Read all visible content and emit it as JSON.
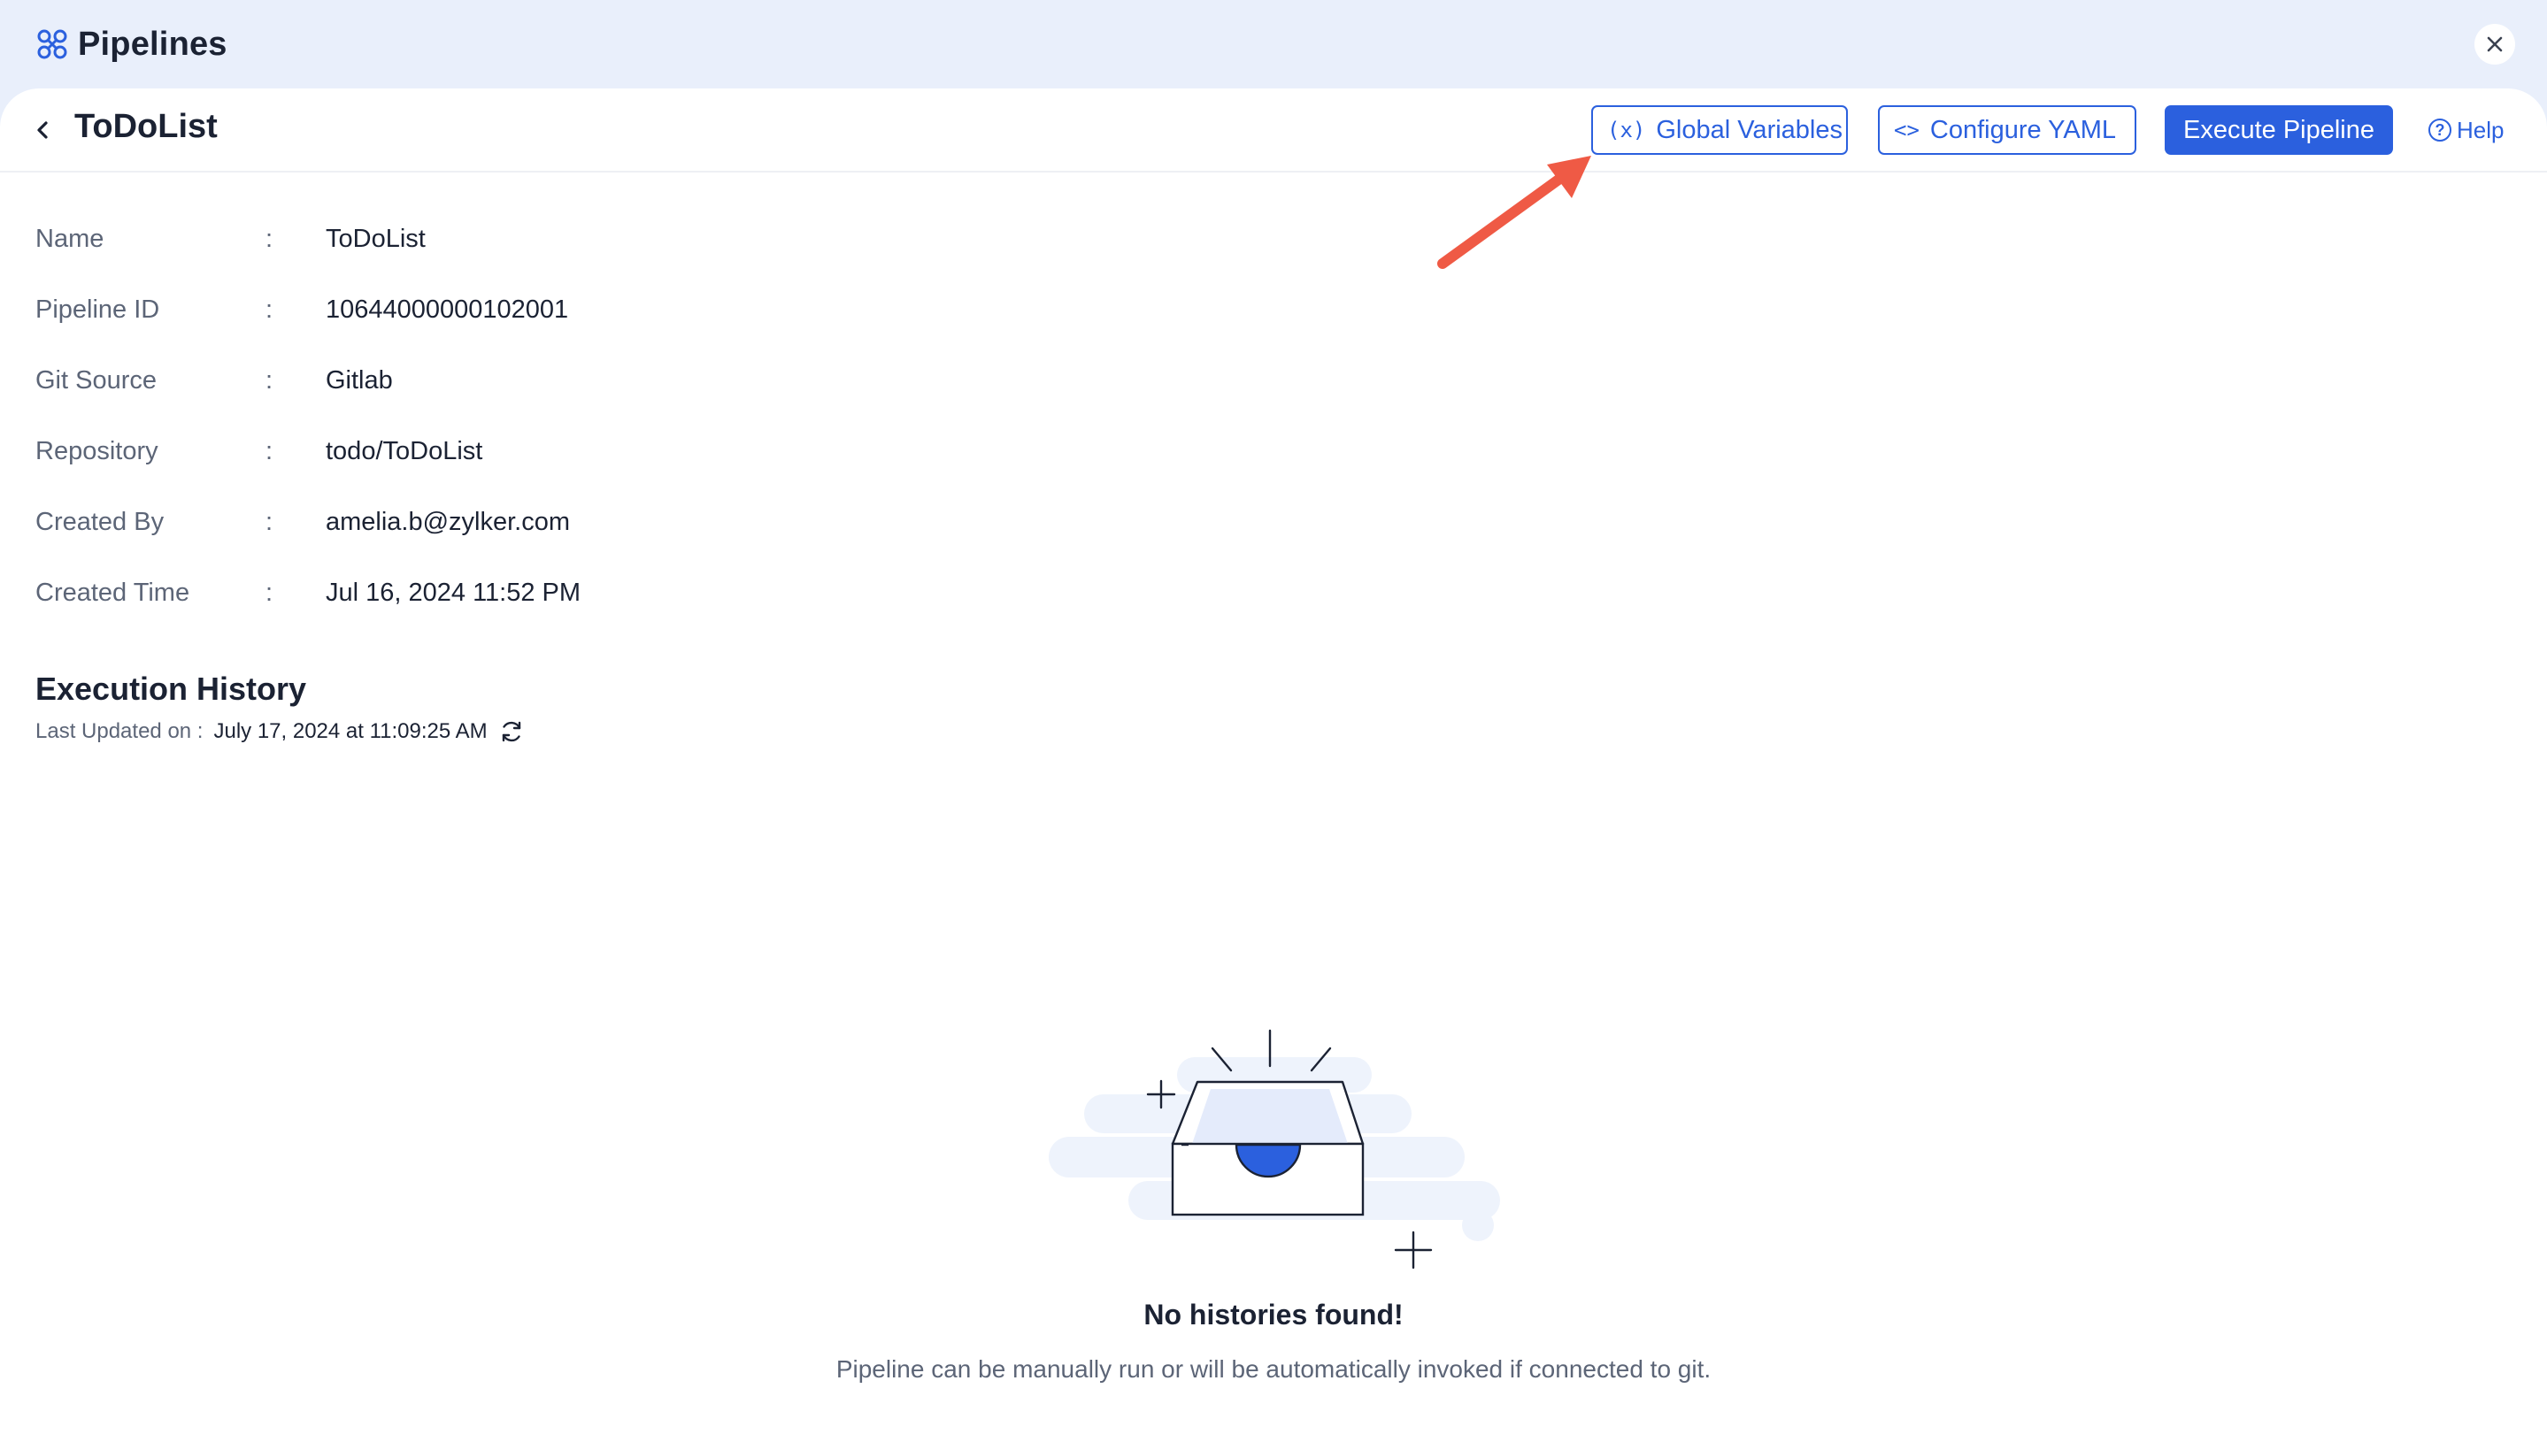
{
  "app": {
    "title": "Pipelines"
  },
  "header": {
    "pipeline_name": "ToDoList",
    "buttons": {
      "global_variables": "Global Variables",
      "global_variables_icon": "(x)",
      "configure_yaml": "Configure YAML",
      "configure_yaml_icon": "<>",
      "execute_pipeline": "Execute Pipeline",
      "help": "Help"
    }
  },
  "details": [
    {
      "label": "Name",
      "value": "ToDoList"
    },
    {
      "label": "Pipeline ID",
      "value": "10644000000102001"
    },
    {
      "label": "Git Source",
      "value": "Gitlab"
    },
    {
      "label": "Repository",
      "value": "todo/ToDoList"
    },
    {
      "label": "Created By",
      "value": "amelia.b@zylker.com"
    },
    {
      "label": "Created Time",
      "value": "Jul 16, 2024 11:52 PM"
    }
  ],
  "history": {
    "title": "Execution History",
    "last_updated_label": "Last Updated on :",
    "last_updated_value": "July 17, 2024 at 11:09:25 AM"
  },
  "empty_state": {
    "title": "No histories found!",
    "description": "Pipeline can be manually run or will be automatically invoked if connected to git."
  },
  "colors": {
    "accent": "#2b60de",
    "annotation_arrow": "#ef5a45",
    "title_bar_bg": "#e9effb"
  }
}
